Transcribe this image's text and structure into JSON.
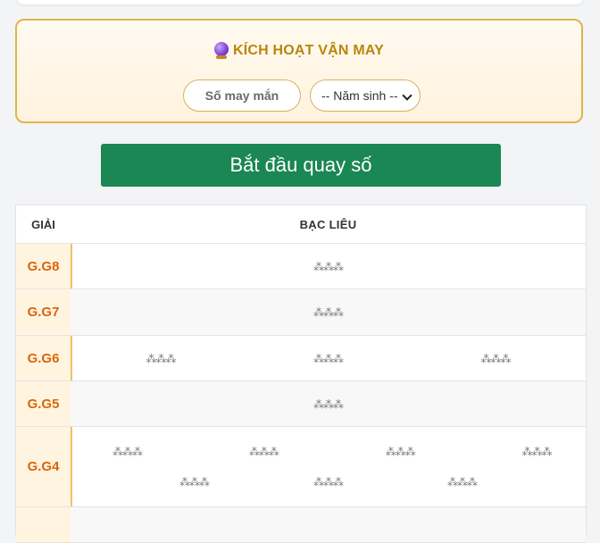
{
  "luck": {
    "title": "KÍCH HOẠT VẬN MAY",
    "icon": "crystal-ball-icon",
    "lucky_placeholder": "Số may mắn",
    "year_select": "-- Năm sinh --"
  },
  "spin_label": "Bắt đầu quay số",
  "table": {
    "header": {
      "prize_col": "GIẢI",
      "province": "BẠC LIÊU"
    },
    "loading_glyph": "⁂⁂⁂",
    "rows": [
      {
        "label": "G.G8",
        "count": 1
      },
      {
        "label": "G.G7",
        "count": 1
      },
      {
        "label": "G.G6",
        "count": 3
      },
      {
        "label": "G.G5",
        "count": 1
      },
      {
        "label": "G.G4",
        "count": 7
      }
    ]
  },
  "colors": {
    "accent": "#1a8754",
    "prize_label": "#d9660b",
    "luck_title": "#b8860b",
    "luck_border": "#e0b44a"
  }
}
